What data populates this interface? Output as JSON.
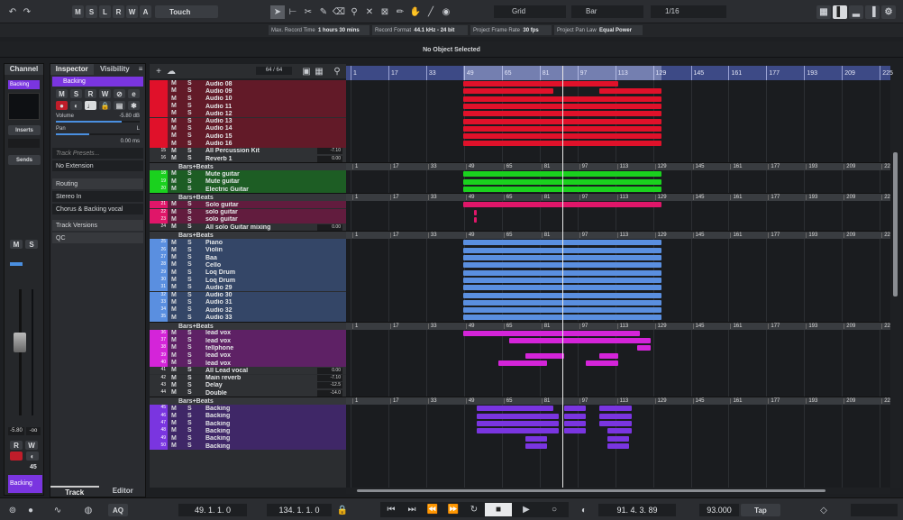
{
  "toolbar": {
    "state_buttons": [
      "M",
      "S",
      "L",
      "R",
      "W",
      "A"
    ],
    "automation_mode": "Touch",
    "snap_type": "Grid",
    "grid_type": "Bar",
    "quantize": "1/16"
  },
  "project_info": [
    {
      "label": "Max. Record Time",
      "value": "1 hours 30 mins"
    },
    {
      "label": "Record Format",
      "value": "44.1 kHz - 24 bit"
    },
    {
      "label": "Project Frame Rate",
      "value": "30 fps"
    },
    {
      "label": "Project Pan Law",
      "value": "Equal Power"
    }
  ],
  "status": "No Object Selected",
  "channel": {
    "title": "Channel",
    "track": "Backing",
    "inserts": "Inserts",
    "sends": "Sends",
    "fader_value": "-5.80",
    "fader_right": "-oo",
    "r": "R",
    "w": "W",
    "value_45": "45",
    "name_bottom": "Backing"
  },
  "inspector": {
    "tab1": "Inspector",
    "tab2": "Visibility",
    "track_name": "Backing",
    "volume_label": "Volume",
    "volume_value": "-5.80 dB",
    "pan_label": "Pan",
    "pan_value": "L",
    "delay_value": "0.00 ms",
    "presets": "Track Presets...",
    "extension": "No Extension",
    "routing": "Routing",
    "input": "Stereo In",
    "output": "Chorus & Backing vocal",
    "versions": "Track Versions",
    "qc": "QC",
    "bottom_tab1": "Track",
    "bottom_tab2": "Editor"
  },
  "tracklist": {
    "count": "64 / 64"
  },
  "ruler": {
    "bars": [
      "1",
      "17",
      "33",
      "49",
      "65",
      "81",
      "97",
      "113",
      "129",
      "145",
      "161",
      "177",
      "193",
      "209",
      "225"
    ]
  },
  "folder_label": "Bars+Beats",
  "tracks": [
    {
      "n": "",
      "name": "Audio 08",
      "c": "#e0112a",
      "g": "red"
    },
    {
      "n": "",
      "name": "Audio 09",
      "c": "#e0112a",
      "g": "red"
    },
    {
      "n": "",
      "name": "Audio 10",
      "c": "#e0112a",
      "g": "red"
    },
    {
      "n": "",
      "name": "Audio 11",
      "c": "#e0112a",
      "g": "red"
    },
    {
      "n": "",
      "name": "Audio 12",
      "c": "#e0112a",
      "g": "red"
    },
    {
      "n": "",
      "name": "Audio 13",
      "c": "#e0112a",
      "g": "red"
    },
    {
      "n": "",
      "name": "Audio 14",
      "c": "#e0112a",
      "g": "red"
    },
    {
      "n": "",
      "name": "Audio 15",
      "c": "#e0112a",
      "g": "red"
    },
    {
      "n": "",
      "name": "Audio 16",
      "c": "#e0112a",
      "g": "red"
    },
    {
      "n": "15",
      "name": "All Percussion Kit",
      "c": "#5a5c60",
      "vol": "-7.10",
      "fx": true
    },
    {
      "n": "16",
      "name": "Reverb 1",
      "c": "#5a5c60",
      "vol": "0.00",
      "fx": true
    },
    {
      "folder": true
    },
    {
      "n": "18",
      "name": "Mute guitar",
      "c": "#1ad11e",
      "g": "green"
    },
    {
      "n": "19",
      "name": "Mute guitar",
      "c": "#1ad11e",
      "g": "green"
    },
    {
      "n": "20",
      "name": "Electric Guitar",
      "c": "#1ad11e",
      "g": "green"
    },
    {
      "folder": true
    },
    {
      "n": "21",
      "name": "Solo guitar",
      "c": "#e01669",
      "g": "pink"
    },
    {
      "n": "22",
      "name": "solo guitar",
      "c": "#e01669",
      "g": "pink"
    },
    {
      "n": "23",
      "name": "solo guitar",
      "c": "#e01669",
      "g": "pink"
    },
    {
      "n": "24",
      "name": "All solo Guitar mixing",
      "c": "#5a5c60",
      "vol": "0.00",
      "fx": true
    },
    {
      "folder": true
    },
    {
      "n": "25",
      "name": "Piano",
      "c": "#5a8fe0",
      "g": "blue"
    },
    {
      "n": "26",
      "name": "Violin",
      "c": "#5a8fe0",
      "g": "blue"
    },
    {
      "n": "27",
      "name": "Baa",
      "c": "#5a8fe0",
      "g": "blue"
    },
    {
      "n": "28",
      "name": "Cello",
      "c": "#5a8fe0",
      "g": "blue"
    },
    {
      "n": "29",
      "name": "Loq Drum",
      "c": "#5a8fe0",
      "g": "blue"
    },
    {
      "n": "30",
      "name": "Loq Drum",
      "c": "#5a8fe0",
      "g": "blue"
    },
    {
      "n": "31",
      "name": "Audio 29",
      "c": "#5a8fe0",
      "g": "blue"
    },
    {
      "n": "32",
      "name": "Audio 30",
      "c": "#5a8fe0",
      "g": "blue"
    },
    {
      "n": "33",
      "name": "Audio 31",
      "c": "#5a8fe0",
      "g": "blue"
    },
    {
      "n": "34",
      "name": "Audio 32",
      "c": "#5a8fe0",
      "g": "blue"
    },
    {
      "n": "35",
      "name": "Audio 33",
      "c": "#5a8fe0",
      "g": "blue"
    },
    {
      "folder": true
    },
    {
      "n": "36",
      "name": "lead vox",
      "c": "#d424d9",
      "g": "magenta"
    },
    {
      "n": "37",
      "name": "lead vox",
      "c": "#d424d9",
      "g": "magenta"
    },
    {
      "n": "38",
      "name": "tellphone",
      "c": "#d424d9",
      "g": "magenta"
    },
    {
      "n": "39",
      "name": "lead vox",
      "c": "#d424d9",
      "g": "magenta"
    },
    {
      "n": "40",
      "name": "lead vox",
      "c": "#d424d9",
      "g": "magenta"
    },
    {
      "n": "41",
      "name": "All Lead vocal",
      "c": "#5a5c60",
      "vol": "0.00",
      "fx": true
    },
    {
      "n": "42",
      "name": "Main reverb",
      "c": "#5a5c60",
      "vol": "-7.10",
      "fx": true
    },
    {
      "n": "43",
      "name": "Delay",
      "c": "#5a5c60",
      "vol": "-12.5",
      "fx": true
    },
    {
      "n": "44",
      "name": "Double",
      "c": "#5a5c60",
      "vol": "-14.0",
      "fx": true
    },
    {
      "folder": true
    },
    {
      "n": "45",
      "name": "Backing",
      "c": "#7a35e0",
      "g": "purple"
    },
    {
      "n": "46",
      "name": "Backing",
      "c": "#7a35e0",
      "g": "purple"
    },
    {
      "n": "47",
      "name": "Backing",
      "c": "#7a35e0",
      "g": "purple"
    },
    {
      "n": "48",
      "name": "Backing",
      "c": "#7a35e0",
      "g": "purple"
    },
    {
      "n": "49",
      "name": "Backing",
      "c": "#7a35e0",
      "g": "purple"
    },
    {
      "n": "50",
      "name": "Backing",
      "c": "#7a35e0",
      "g": "purple"
    }
  ],
  "transport": {
    "left_locator": "49. 1. 1. 0",
    "right_locator": "134. 1. 1. 0",
    "position": "91. 4. 3. 89",
    "tempo": "93.000",
    "tap": "Tap",
    "aq": "AQ"
  },
  "colors": {
    "ruler": "#3d4a86",
    "red": "#e0112a",
    "green": "#1ad11e",
    "pink": "#e01669",
    "blue": "#5a8fe0",
    "magenta": "#d424d9",
    "purple": "#7a35e0"
  }
}
